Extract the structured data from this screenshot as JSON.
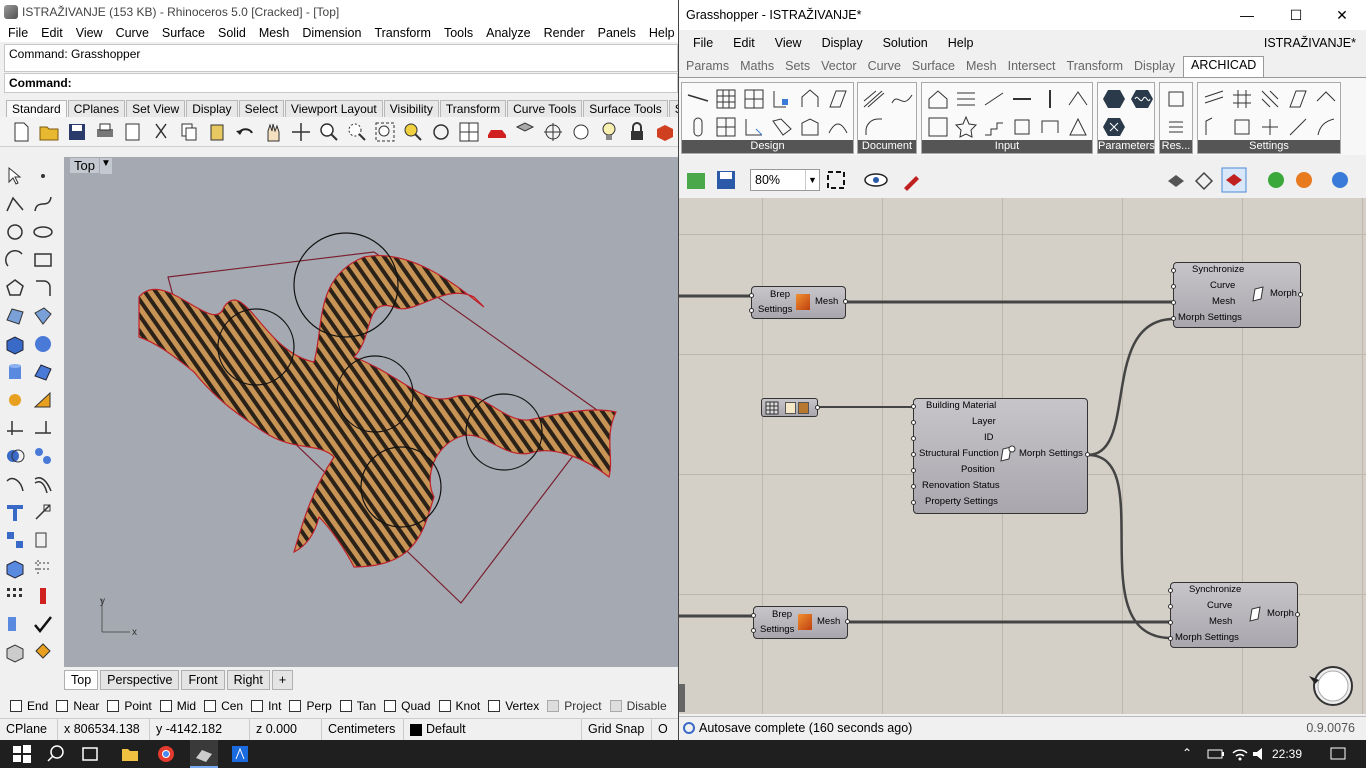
{
  "rhino": {
    "title": "ISTRAŽIVANJE (153 KB) - Rhinoceros 5.0 [Cracked] - [Top]",
    "menu": [
      "File",
      "Edit",
      "View",
      "Curve",
      "Surface",
      "Solid",
      "Mesh",
      "Dimension",
      "Transform",
      "Tools",
      "Analyze",
      "Render",
      "Panels",
      "Help"
    ],
    "command_history": "Command: Grasshopper",
    "command_prompt": "Command:",
    "toolbar_tabs": [
      "Standard",
      "CPlanes",
      "Set View",
      "Display",
      "Select",
      "Viewport Layout",
      "Visibility",
      "Transform",
      "Curve Tools",
      "Surface Tools",
      "S"
    ],
    "viewport_label": "Top",
    "viewport_tabs": [
      "Top",
      "Perspective",
      "Front",
      "Right",
      "+"
    ],
    "axis_x": "x",
    "axis_y": "y",
    "osnaps": [
      {
        "label": "End",
        "disabled": false
      },
      {
        "label": "Near",
        "disabled": false
      },
      {
        "label": "Point",
        "disabled": false
      },
      {
        "label": "Mid",
        "disabled": false
      },
      {
        "label": "Cen",
        "disabled": false
      },
      {
        "label": "Int",
        "disabled": false
      },
      {
        "label": "Perp",
        "disabled": false
      },
      {
        "label": "Tan",
        "disabled": false
      },
      {
        "label": "Quad",
        "disabled": false
      },
      {
        "label": "Knot",
        "disabled": false
      },
      {
        "label": "Vertex",
        "disabled": false
      },
      {
        "label": "Project",
        "disabled": true
      },
      {
        "label": "Disable",
        "disabled": true
      }
    ],
    "status": {
      "cplane": "CPlane",
      "x": "x 806534.138",
      "y": "y -4142.182",
      "z": "z 0.000",
      "units": "Centimeters",
      "layer": "Default",
      "grid_snap": "Grid Snap",
      "more": "O"
    }
  },
  "grasshopper": {
    "title": "Grasshopper - ISTRAŽIVANJE*",
    "menu": [
      "File",
      "Edit",
      "View",
      "Display",
      "Solution",
      "Help"
    ],
    "document": "ISTRAŽIVANJE*",
    "tabs": [
      "Params",
      "Maths",
      "Sets",
      "Vector",
      "Curve",
      "Surface",
      "Mesh",
      "Intersect",
      "Transform",
      "Display",
      "ARCHICAD"
    ],
    "active_tab": "ARCHICAD",
    "ribbon_groups": [
      "Design",
      "Document",
      "Input",
      "Parameters",
      "Res...",
      "Settings"
    ],
    "zoom": "80%",
    "nodes": {
      "mesh_top": {
        "inputs": [
          "Brep",
          "Settings"
        ],
        "output": "Mesh"
      },
      "morph_top": {
        "inputs": [
          "Synchronize",
          "Curve",
          "Mesh",
          "Morph Settings"
        ],
        "output": "Morph"
      },
      "settings": {
        "inputs": [
          "Building Material",
          "Layer",
          "ID",
          "Structural Function",
          "Position",
          "Renovation Status",
          "Property Settings"
        ],
        "output": "Morph Settings"
      },
      "mesh_bottom": {
        "inputs": [
          "Brep",
          "Settings"
        ],
        "output": "Mesh"
      },
      "morph_bottom": {
        "inputs": [
          "Synchronize",
          "Curve",
          "Mesh",
          "Morph Settings"
        ],
        "output": "Morph"
      }
    },
    "status": "Autosave complete (160 seconds ago)",
    "version": "0.9.0076"
  },
  "taskbar": {
    "clock": "22:39"
  },
  "colors": {
    "viewport_bg": "#a5aab2",
    "canvas_bg": "#d4d0c8",
    "geometry_fill": "#b5864a",
    "outline_red": "#c0202a"
  }
}
